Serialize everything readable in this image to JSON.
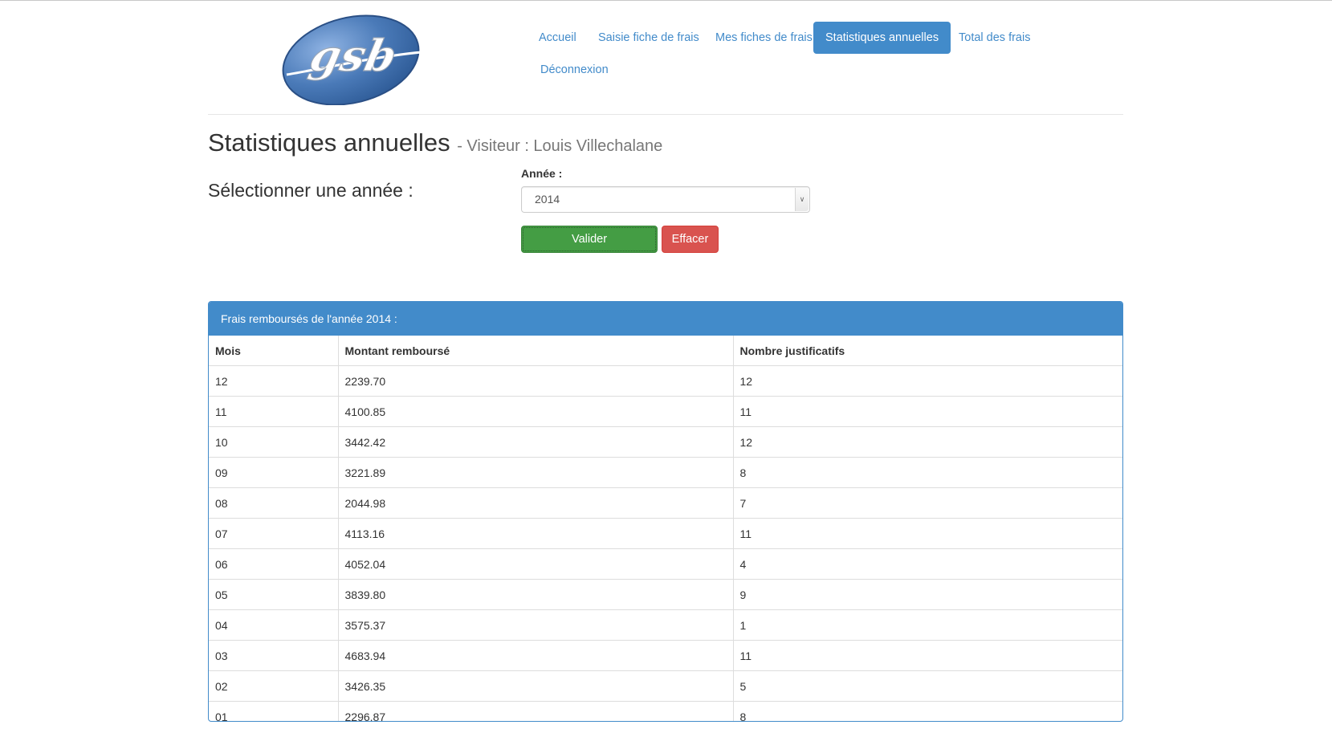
{
  "logo": {
    "text": "gsb",
    "color": "#4a7ab8"
  },
  "nav": {
    "items": [
      {
        "label": "Accueil",
        "active": false
      },
      {
        "label": "Saisie fiche de frais",
        "active": false
      },
      {
        "label": "Mes fiches de frais",
        "active": false
      },
      {
        "label": "Statistiques annuelles",
        "active": true
      },
      {
        "label": "Total des frais",
        "active": false
      },
      {
        "label": "Déconnexion",
        "active": false
      }
    ]
  },
  "page": {
    "title": "Statistiques annuelles",
    "subtitle": "- Visiteur : Louis Villechalane",
    "select_label": "Sélectionner une année :"
  },
  "form": {
    "year_label": "Année :",
    "year_value": "2014",
    "submit_label": "Valider",
    "reset_label": "Effacer"
  },
  "panel": {
    "heading": "Frais remboursés de l'année 2014 :",
    "columns": [
      "Mois",
      "Montant remboursé",
      "Nombre justificatifs"
    ],
    "rows": [
      [
        "12",
        "2239.70",
        "12"
      ],
      [
        "11",
        "4100.85",
        "11"
      ],
      [
        "10",
        "3442.42",
        "12"
      ],
      [
        "09",
        "3221.89",
        "8"
      ],
      [
        "08",
        "2044.98",
        "7"
      ],
      [
        "07",
        "4113.16",
        "11"
      ],
      [
        "06",
        "4052.04",
        "4"
      ],
      [
        "05",
        "3839.80",
        "9"
      ],
      [
        "04",
        "3575.37",
        "1"
      ],
      [
        "03",
        "4683.94",
        "11"
      ],
      [
        "02",
        "3426.35",
        "5"
      ],
      [
        "01",
        "2296.87",
        "8"
      ]
    ]
  },
  "colors": {
    "primary": "#428bca",
    "success": "#449d44",
    "danger": "#d9534f"
  }
}
